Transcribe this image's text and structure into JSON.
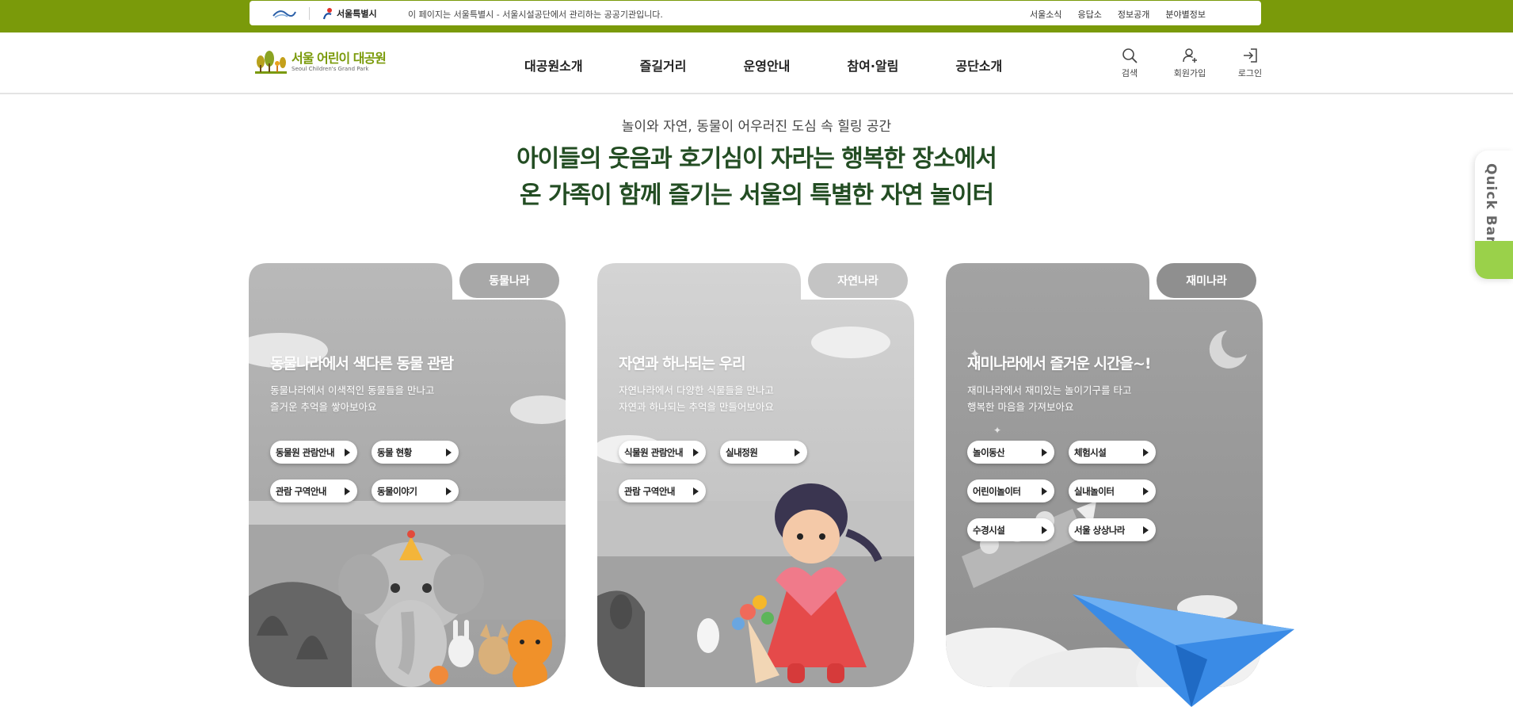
{
  "gov_bar": {
    "seoul_label": "서울특별시",
    "notice": "이 페이지는 서울특별시 - 서울시설공단에서 관리하는 공공기관입니다.",
    "links": [
      "서울소식",
      "응답소",
      "정보공개",
      "분야별정보"
    ]
  },
  "header": {
    "logo_ko": "서울 어린이 대공원",
    "logo_en": "Seoul Children's Grand Park",
    "nav": [
      "대공원소개",
      "즐길거리",
      "운영안내",
      "참여·알림",
      "공단소개"
    ],
    "utils": [
      "검색",
      "회원가입",
      "로그인"
    ]
  },
  "hero": {
    "subtitle": "놀이와 자연, 동물이 어우러진 도심 속 힐링 공간",
    "title_line1": "아이들의 웃음과 호기심이 자라는 행복한 장소에서",
    "title_line2": "온 가족이 함께 즐기는 서울의 특별한 자연 놀이터"
  },
  "quick_bar": {
    "label": "Quick Bar"
  },
  "cards": [
    {
      "tab": "동물나라",
      "heading": "동물나라에서 색다른 동물 관람",
      "desc": "동물나라에서 이색적인 동물들을 만나고\n즐거운 추억을 쌓아보아요",
      "buttons": [
        "동물원 관람안내",
        "동물 현황",
        "관람 구역안내",
        "동물이야기"
      ]
    },
    {
      "tab": "자연나라",
      "heading": "자연과 하나되는 우리",
      "desc": "자연나라에서 다양한 식물들을 만나고\n자연과 하나되는 추억을 만들어보아요",
      "buttons": [
        "식물원 관람안내",
        "실내정원",
        "관람 구역안내"
      ]
    },
    {
      "tab": "재미나라",
      "heading": "재미나라에서 즐거운 시간을~!",
      "desc": "재미나라에서 재미있는 놀이기구를 타고\n행복한 마음을 가져보아요",
      "buttons": [
        "놀이동산",
        "체험시설",
        "어린이놀이터",
        "실내놀이터",
        "수경시설",
        "서울 상상나라"
      ]
    }
  ],
  "colors": {
    "gov_green": "#7a9a0a",
    "title_green": "#234d23",
    "quickbar_green": "#9ad14a",
    "tab_gray": "#a8a8a8",
    "tab_active": "#8f8f8f"
  }
}
